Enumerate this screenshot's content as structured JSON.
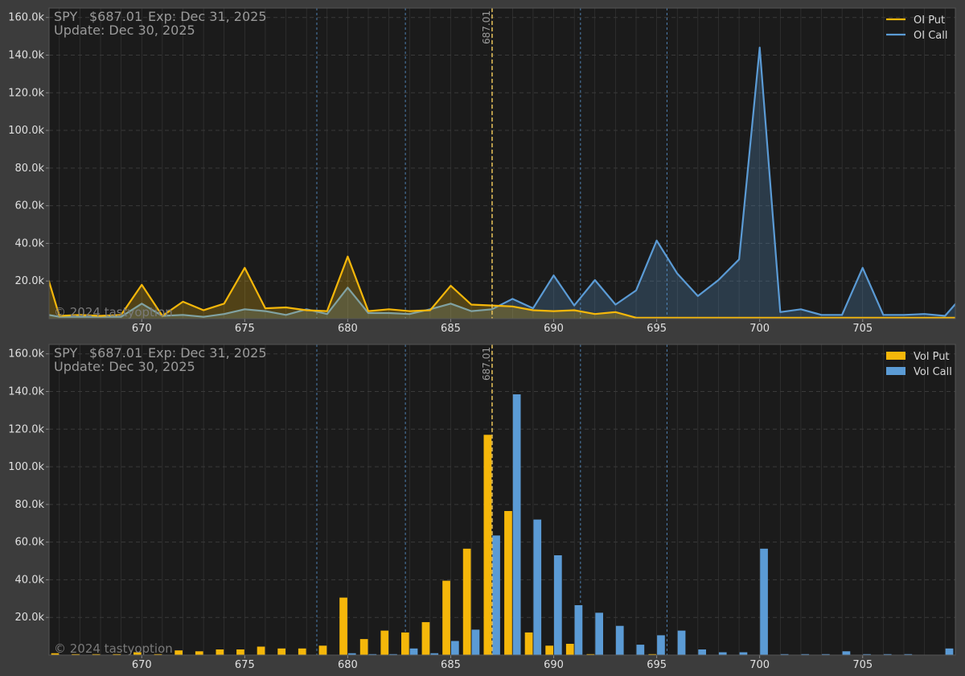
{
  "colors": {
    "background": "#3c3c3c",
    "plot_background": "#1b1b1b",
    "put": "#f5b70a",
    "call": "#5b9bd5",
    "price_line": "#e8c25a",
    "grid": "#3a3a3a",
    "text": "#9a9a9a"
  },
  "header": {
    "ticker": "SPY",
    "price": "$687.01",
    "expiry": "Exp: Dec 31, 2025",
    "update": "Update: Dec 30, 2025",
    "watermark": "© 2024 tastyoption"
  },
  "price_marker_label": "687.01",
  "chart_data": [
    {
      "type": "area",
      "legend": [
        "OI Put",
        "OI Call"
      ],
      "legend_position": "top-right",
      "grid": true,
      "xlim": [
        665.5,
        709.5
      ],
      "ylim": [
        0,
        165000
      ],
      "price": 687.01,
      "reference_strikes": [
        678.5,
        682.8,
        691.3,
        695.5
      ],
      "x_ticks": [
        670,
        675,
        680,
        685,
        690,
        695,
        700,
        705
      ],
      "y_ticks": [
        20000,
        40000,
        60000,
        80000,
        100000,
        120000,
        140000,
        160000
      ],
      "y_tick_labels": [
        "20.0k",
        "40.0k",
        "60.0k",
        "80.0k",
        "100.0k",
        "120.0k",
        "140.0k",
        "160.0k"
      ],
      "x": [
        665,
        666,
        667,
        668,
        669,
        670,
        671,
        672,
        673,
        674,
        675,
        676,
        677,
        678,
        679,
        680,
        681,
        682,
        683,
        684,
        685,
        686,
        687,
        688,
        689,
        690,
        691,
        692,
        693,
        694,
        695,
        696,
        697,
        698,
        699,
        700,
        701,
        702,
        703,
        704,
        705,
        706,
        707,
        708,
        709,
        710
      ],
      "series": [
        {
          "name": "OI Put",
          "values": [
            38000,
            1500,
            2000,
            1500,
            2000,
            18000,
            1500,
            9000,
            4500,
            8000,
            27000,
            5500,
            6000,
            4500,
            4000,
            33000,
            4000,
            5000,
            4000,
            4500,
            17500,
            7500,
            7000,
            6500,
            4500,
            4000,
            4500,
            2500,
            3500,
            500,
            500,
            500,
            500,
            500,
            500,
            500,
            500,
            500,
            500,
            500,
            500,
            500,
            500,
            500,
            500,
            500
          ]
        },
        {
          "name": "OI Call",
          "values": [
            3000,
            1000,
            1000,
            1000,
            1000,
            8000,
            1500,
            2000,
            1000,
            2500,
            5000,
            4000,
            2000,
            5000,
            2500,
            16500,
            3000,
            3000,
            2500,
            5000,
            8000,
            4000,
            5000,
            10500,
            5500,
            23000,
            7000,
            20500,
            7500,
            15000,
            41500,
            24000,
            12000,
            20500,
            31500,
            144000,
            3500,
            5000,
            2000,
            2000,
            27000,
            2000,
            2000,
            2500,
            1500,
            14000
          ]
        }
      ]
    },
    {
      "type": "bar",
      "legend": [
        "Vol Put",
        "Vol Call"
      ],
      "legend_position": "top-right",
      "grid": true,
      "xlim": [
        665.5,
        709.5
      ],
      "ylim": [
        0,
        165000
      ],
      "price": 687.01,
      "reference_strikes": [
        678.5,
        682.8,
        691.3,
        695.5
      ],
      "x_ticks": [
        670,
        675,
        680,
        685,
        690,
        695,
        700,
        705
      ],
      "y_ticks": [
        20000,
        40000,
        60000,
        80000,
        100000,
        120000,
        140000,
        160000
      ],
      "y_tick_labels": [
        "20.0k",
        "40.0k",
        "60.0k",
        "80.0k",
        "100.0k",
        "120.0k",
        "140.0k",
        "160.0k"
      ],
      "x": [
        666,
        667,
        668,
        669,
        670,
        671,
        672,
        673,
        674,
        675,
        676,
        677,
        678,
        679,
        680,
        681,
        682,
        683,
        684,
        685,
        686,
        687,
        688,
        689,
        690,
        691,
        692,
        693,
        694,
        695,
        696,
        697,
        698,
        699,
        700,
        701,
        702,
        703,
        704,
        705,
        706,
        707,
        708,
        709
      ],
      "series": [
        {
          "name": "Vol Put",
          "values": [
            1000,
            500,
            500,
            500,
            1500,
            500,
            2500,
            2000,
            3000,
            3000,
            4500,
            3500,
            3500,
            5000,
            30500,
            8500,
            13000,
            12000,
            17500,
            39500,
            56500,
            117000,
            76500,
            12000,
            5000,
            6000,
            500,
            0,
            0,
            500,
            0,
            0,
            0,
            0,
            0,
            0,
            0,
            0,
            0,
            0,
            0,
            0,
            0,
            0
          ]
        },
        {
          "name": "Vol Call",
          "values": [
            0,
            0,
            0,
            0,
            0,
            0,
            0,
            0,
            0,
            0,
            0,
            0,
            0,
            0,
            1000,
            500,
            500,
            3500,
            1000,
            7500,
            13500,
            63500,
            138500,
            72000,
            53000,
            26500,
            22500,
            15500,
            5500,
            10500,
            13000,
            3000,
            1500,
            1500,
            56500,
            500,
            500,
            500,
            2000,
            500,
            500,
            500,
            0,
            3500
          ]
        }
      ]
    }
  ]
}
